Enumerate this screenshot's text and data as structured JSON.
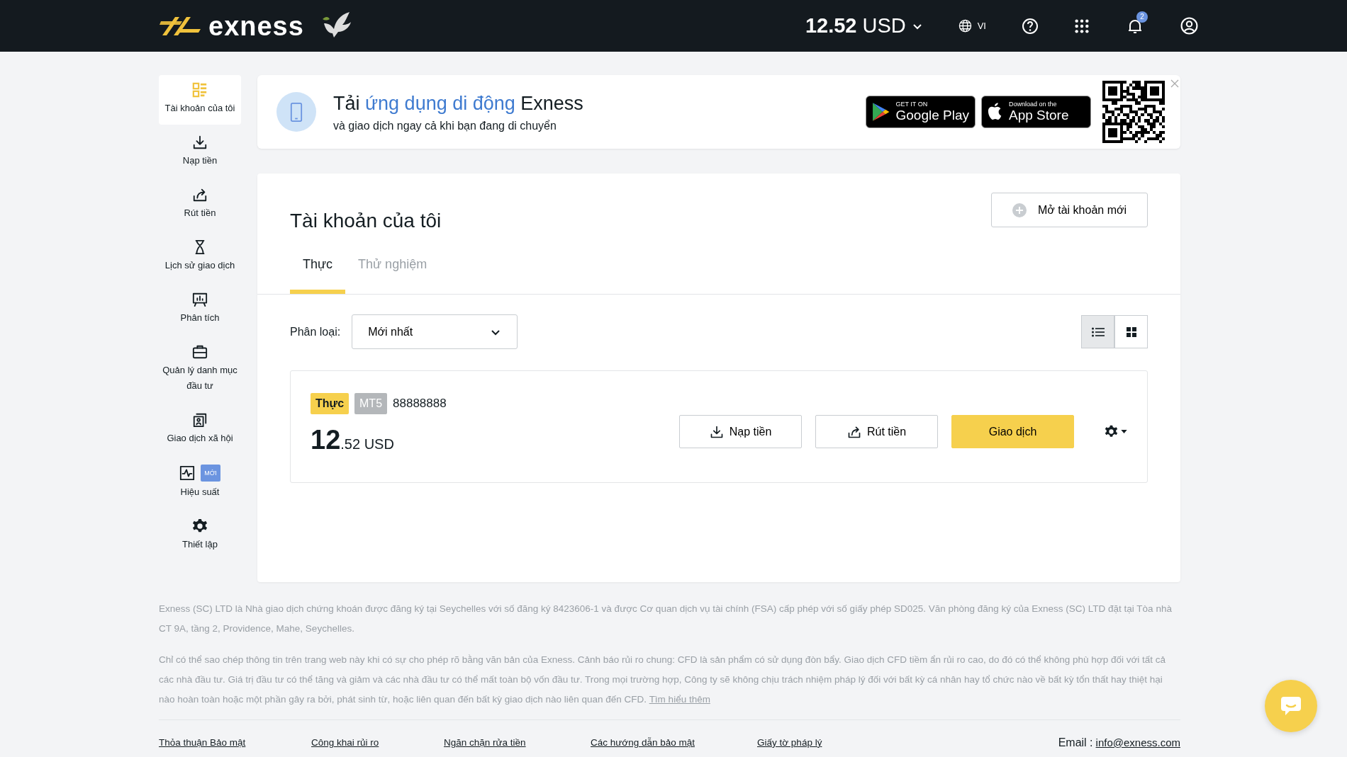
{
  "header": {
    "logo_text": "exness",
    "balance": "12.52",
    "currency": "USD",
    "language": "VI",
    "notification_count": "2"
  },
  "sidebar": {
    "items": [
      {
        "kind": "accounts",
        "label": "Tài khoản của tôi",
        "selected": true
      },
      {
        "kind": "deposit",
        "label": "Nạp tiền",
        "selected": false
      },
      {
        "kind": "withdraw",
        "label": "Rút tiền",
        "selected": false
      },
      {
        "kind": "history",
        "label": "Lịch sử giao dịch",
        "selected": false
      },
      {
        "kind": "analytics",
        "label": "Phân tích",
        "selected": false
      },
      {
        "kind": "portfolio",
        "label": "Quản lý danh mục đầu tư",
        "selected": false
      },
      {
        "kind": "social",
        "label": "Giao dịch xã hội",
        "selected": false
      },
      {
        "kind": "performance",
        "label": "Hiệu suất",
        "selected": false,
        "badge": "MỚI"
      },
      {
        "kind": "settings",
        "label": "Thiết lập",
        "selected": false
      }
    ]
  },
  "banner": {
    "title_start": "Tải",
    "title_highlight": "ứng dụng di động",
    "title_end": "Exness",
    "subtitle": "và giao dịch ngay cả khi bạn đang di chuyển",
    "stores": [
      {
        "kind": "google",
        "small": "GET IT ON",
        "big": "Google Play"
      },
      {
        "kind": "apple",
        "small": "Download on the",
        "big": "App Store"
      }
    ]
  },
  "main": {
    "title": "Tài khoản của tôi",
    "open_account_button": "Mở tài khoản mới",
    "tabs": [
      {
        "label": "Thực",
        "selected": true
      },
      {
        "label": "Thử nghiệm",
        "selected": false
      }
    ],
    "filter_label": "Phân loại:",
    "filter_value": "Mới nhất",
    "view_toggles": [
      {
        "kind": "list",
        "selected": true
      },
      {
        "kind": "grid",
        "selected": false
      }
    ],
    "account": {
      "type": "Thực",
      "platform": "MT5",
      "number": "88888888",
      "balance_int": "12",
      "balance_dec": ".52",
      "currency": "USD",
      "buttons": [
        {
          "kind": "deposit",
          "label": "Nạp tiền"
        },
        {
          "kind": "withdraw",
          "label": "Rút tiền"
        },
        {
          "kind": "trade",
          "label": "Giao dịch"
        }
      ]
    }
  },
  "footer": {
    "paragraphs": [
      {
        "text": "Exness (SC) LTD là Nhà giao dịch chứng khoán được đăng ký tại Seychelles với số đăng ký 8423606-1 và được Cơ quan dịch vụ tài chính (FSA) cấp phép với số giấy phép SD025. Văn phòng đăng ký của Exness (SC) LTD đặt tại Tòa nhà CT 9A, tầng 2, Providence, Mahe, Seychelles."
      },
      {
        "text": "Chỉ có thể sao chép thông tin trên trang web này khi có sự cho phép rõ bằng văn bản của Exness. Cảnh báo rủi ro chung: CFD là sản phẩm có sử dụng đòn bẩy. Giao dịch CFD tiềm ẩn rủi ro cao, do đó có thể không phù hợp đối với tất cả các nhà đầu tư. Giá trị đầu tư có thể tăng và giảm và các nhà đầu tư có thể mất toàn bộ vốn đầu tư. Trong mọi trường hợp, Công ty sẽ không chịu trách nhiệm pháp lý đối với bất kỳ cá nhân hay tổ chức nào về bất kỳ tổn thất hay thiệt hại nào hoàn toàn hoặc một phần gây ra bởi, phát sinh từ, hoặc liên quan đến bất kỳ giao dịch nào liên quan đến CFD.",
        "link": "Tìm hiểu thêm"
      }
    ],
    "links": [
      "Thỏa thuận Bảo mật",
      "Công khai rủi ro",
      "Ngăn chặn rửa tiền",
      "Các hướng dẫn bảo mật",
      "Giấy tờ pháp lý"
    ],
    "email_label": "Email :",
    "email": "info@exness.com"
  }
}
